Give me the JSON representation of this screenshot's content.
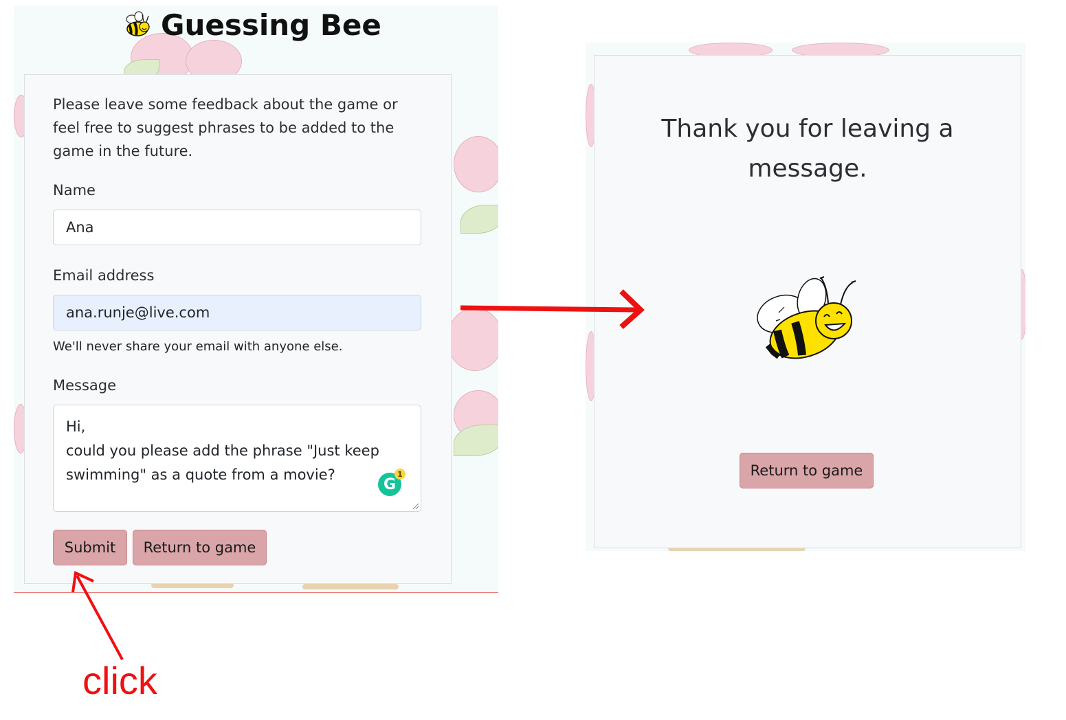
{
  "header": {
    "title": "Guessing Bee",
    "logo_icon": "bee-icon"
  },
  "feedback_form": {
    "intro": "Please leave some feedback about the game or feel free to suggest phrases to be added to the game in the future.",
    "name_label": "Name",
    "name_value": "Ana",
    "email_label": "Email address",
    "email_value": "ana.runje@live.com",
    "email_help": "We'll never share your email with anyone else.",
    "message_label": "Message",
    "message_lines": [
      "Hi,",
      "could you please add the phrase \"Just keep",
      "swimming\" as a quote from a movie?"
    ],
    "grammarly_count": "1",
    "submit_label": "Submit",
    "return_label": "Return to game"
  },
  "thank_you": {
    "message": "Thank you for leaving a message.",
    "return_label": "Return to game",
    "illustration_icon": "bee-icon"
  },
  "annotation": {
    "click_label": "click",
    "color": "#ee1111"
  },
  "colors": {
    "button_bg": "#daa5a8",
    "card_bg": "#f8f9fa",
    "autofill_bg": "#e8f0fe"
  }
}
